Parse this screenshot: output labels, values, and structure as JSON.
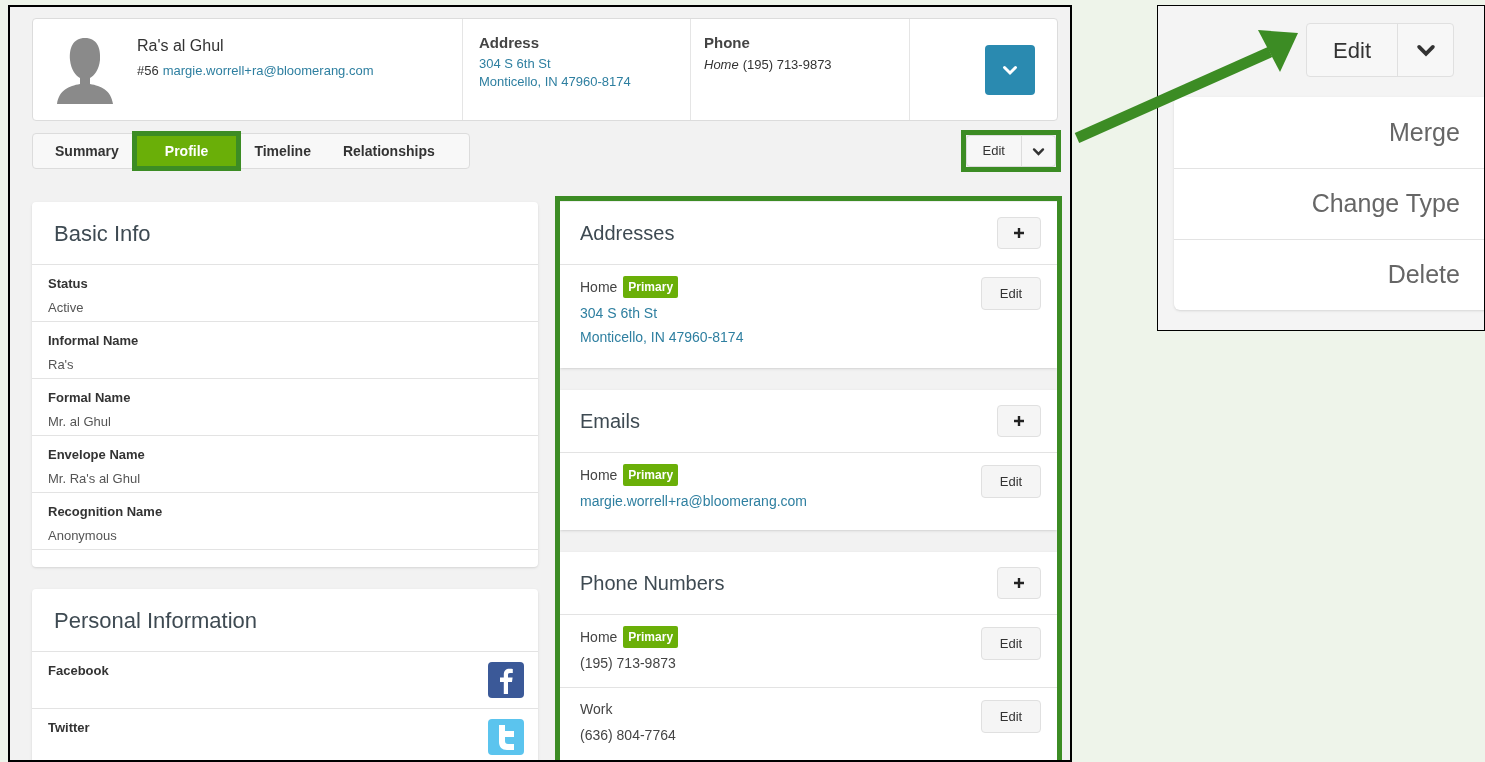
{
  "profile": {
    "name": "Ra's al Ghul",
    "number": "#56",
    "email": "margie.worrell+ra@bloomerang.com",
    "address_label": "Address",
    "address_lines": [
      "304 S 6th St",
      "Monticello, IN 47960-8174"
    ],
    "phone_label": "Phone",
    "phone_type": "Home",
    "phone": "(195) 713-9873"
  },
  "tabs": [
    {
      "label": "Summary",
      "selected": false
    },
    {
      "label": "Profile",
      "selected": true
    },
    {
      "label": "Timeline",
      "selected": false
    },
    {
      "label": "Relationships",
      "selected": false
    }
  ],
  "edit_button": "Edit",
  "basic_info": {
    "title": "Basic Info",
    "fields": [
      {
        "label": "Status",
        "value": "Active"
      },
      {
        "label": "Informal Name",
        "value": "Ra's"
      },
      {
        "label": "Formal Name",
        "value": "Mr. al Ghul"
      },
      {
        "label": "Envelope Name",
        "value": "Mr. Ra's al Ghul"
      },
      {
        "label": "Recognition Name",
        "value": "Anonymous"
      }
    ]
  },
  "personal_info": {
    "title": "Personal Information",
    "fields": [
      {
        "label": "Facebook",
        "kind": "facebook"
      },
      {
        "label": "Twitter",
        "kind": "twitter"
      }
    ]
  },
  "contact_sections": [
    {
      "title": "Addresses",
      "entries": [
        {
          "type": "Home",
          "badge": "Primary",
          "link": true,
          "lines": [
            "304 S 6th St",
            "Monticello, IN 47960-8174"
          ],
          "button": "Edit"
        }
      ]
    },
    {
      "title": "Emails",
      "entries": [
        {
          "type": "Home",
          "badge": "Primary",
          "link": true,
          "lines": [
            "margie.worrell+ra@bloomerang.com"
          ],
          "button": "Edit"
        }
      ]
    },
    {
      "title": "Phone Numbers",
      "entries": [
        {
          "type": "Home",
          "badge": "Primary",
          "link": false,
          "lines": [
            "(195) 713-9873"
          ],
          "button": "Edit"
        },
        {
          "type": "Work",
          "link": false,
          "lines": [
            "(636) 804-7764"
          ],
          "button": "Edit"
        }
      ]
    }
  ],
  "callout": {
    "edit_button": "Edit",
    "menu_items": [
      "Merge",
      "Change Type",
      "Delete"
    ]
  }
}
